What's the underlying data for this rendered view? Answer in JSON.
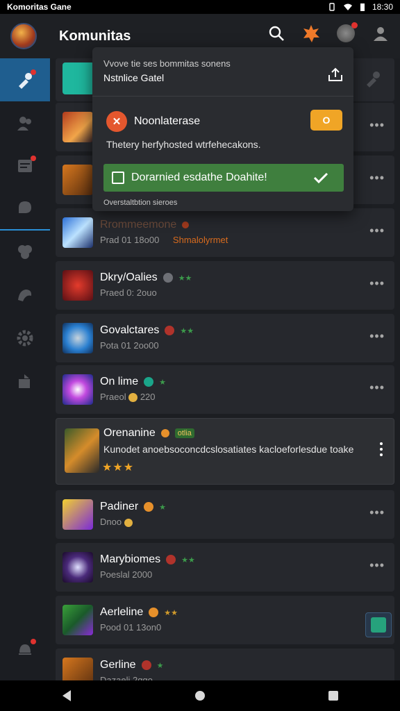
{
  "status_bar": {
    "title": "Komoritas Gane",
    "time": "18:30"
  },
  "app": {
    "title": "Komunitas"
  },
  "popup": {
    "header_line1": "Vvove tie ses bommitas sonens",
    "header_line2": "Nstnlice Gatel",
    "notification_title": "Noonlaterase",
    "toggle_label": "O",
    "notification_desc": "Thetery herfyhosted wtrfehecakons.",
    "success_text": "Dorarnied esdathe Doahite!",
    "footer": "Overstaltbtion sieroes"
  },
  "rows": [
    {
      "name": "",
      "sub": ""
    },
    {
      "name": "",
      "sub": ""
    },
    {
      "name": "Rrommeemone",
      "sub": "Prad 01 18o00",
      "extra": "Shmalolyrmet"
    },
    {
      "name": "Dkry/Oalies",
      "sub": "Praed 0: 2ouo"
    },
    {
      "name": "Govalctares",
      "sub": "Pota 01 2oo00"
    },
    {
      "name": "On lime",
      "sub": "Praeol",
      "sub2": "220"
    },
    {
      "name": "Orenanine",
      "tag": "otlia",
      "desc": "Kunodet anoebsoconcdcslosatiates kacloeforlesdue toake",
      "stars": "★★★"
    },
    {
      "name": "Padiner",
      "sub": "Dnoo"
    },
    {
      "name": "Marybiomes",
      "sub": "Poeslal 2000"
    },
    {
      "name": "Aerleline",
      "sub": "Pood 01 13on0"
    },
    {
      "name": "Gerline",
      "sub": "Dazaeli 2ggo"
    }
  ],
  "icons": {
    "top": [
      "search-icon",
      "burst-icon",
      "avatar-icon",
      "profile-icon"
    ],
    "sidebar": [
      "tools-icon",
      "people-icon",
      "news-icon",
      "chat-icon",
      "puzzle-icon",
      "game-icon",
      "gear-icon",
      "share-icon",
      "bell-icon"
    ]
  },
  "colors": {
    "accent": "#1f5e8f",
    "success": "#3f7f3e",
    "warning": "#f0a526"
  }
}
